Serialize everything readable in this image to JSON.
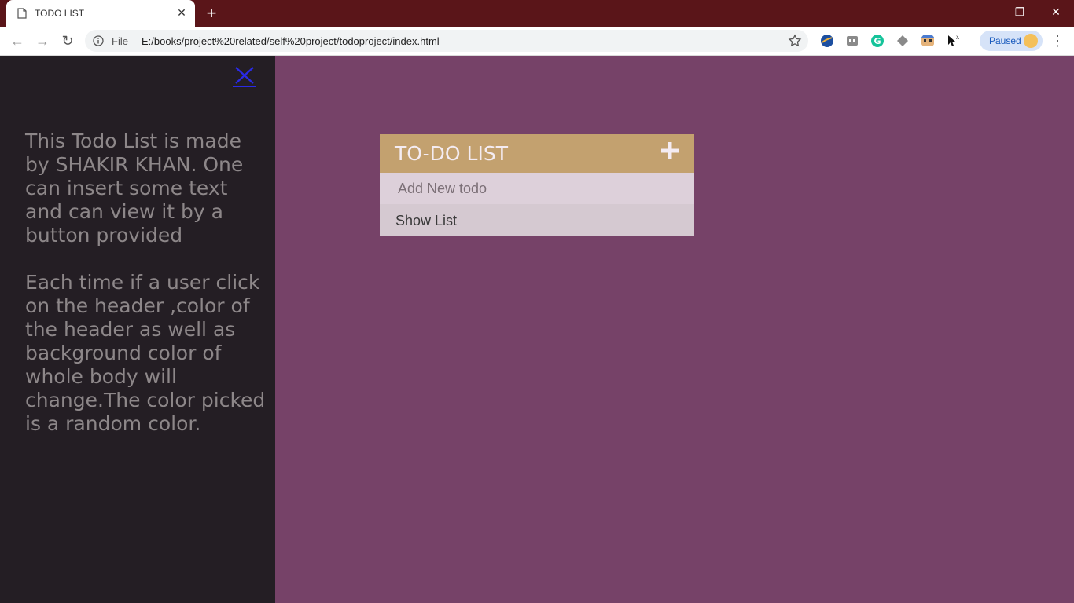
{
  "browser": {
    "tab_title": "TODO LIST",
    "url_scheme": "File",
    "url": "E:/books/project%20related/self%20project/todoproject/index.html",
    "profile_status": "Paused",
    "theme_color": "#5a1519"
  },
  "sidebar": {
    "close_icon": "close-icon",
    "about_paragraph_1": "This Todo List is made by SHAKIR KHAN. One can insert some text and can view it by a button provided",
    "about_paragraph_2": "Each time if a user click on the header ,color of the header as well as background color of whole body will change.The color picked is a random color.",
    "background_color": "#241e24"
  },
  "todo": {
    "title": "TO-DO LIST",
    "add_icon": "plus-icon",
    "input_placeholder": "Add New todo",
    "show_list_label": "Show List",
    "header_color": "#c3a16f",
    "page_background_color": "#764268"
  }
}
